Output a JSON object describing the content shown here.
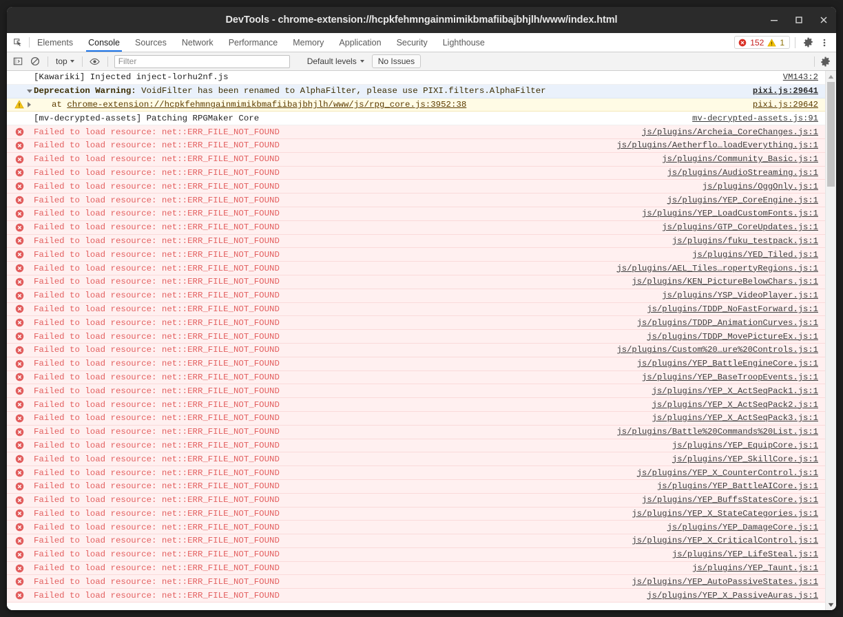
{
  "window": {
    "title": "DevTools - chrome-extension://hcpkfehmngainmimikbmafiibajbhjlh/www/index.html",
    "controls": {
      "minimize": "minimize-button",
      "maximize": "maximize-button",
      "close": "close-button"
    }
  },
  "tabbar": {
    "inspect_icon": "inspect-element-icon",
    "tabs": [
      {
        "label": "Elements",
        "active": false
      },
      {
        "label": "Console",
        "active": true
      },
      {
        "label": "Sources",
        "active": false
      },
      {
        "label": "Network",
        "active": false
      },
      {
        "label": "Performance",
        "active": false
      },
      {
        "label": "Memory",
        "active": false
      },
      {
        "label": "Application",
        "active": false
      },
      {
        "label": "Security",
        "active": false
      },
      {
        "label": "Lighthouse",
        "active": false
      }
    ],
    "error_count": "152",
    "warning_count": "1",
    "settings_icon": "gear-icon",
    "more_icon": "more-vertical-icon"
  },
  "toolbar": {
    "sidebar_icon": "console-sidebar-icon",
    "clear_icon": "clear-console-icon",
    "context": "top",
    "eye_icon": "live-expression-eye-icon",
    "filter_placeholder": "Filter",
    "filter_value": "",
    "levels": "Default levels",
    "no_issues": "No Issues",
    "settings_icon": "console-settings-gear-icon"
  },
  "colors": {
    "accent": "#1a73e8",
    "error": "#e36060",
    "error_bg": "#fff0f0",
    "warn_bg": "#fffbe5",
    "titlebar": "#2b2b2b"
  },
  "console": {
    "error_text": "Failed to load resource: net::ERR_FILE_NOT_FOUND",
    "messages": [
      {
        "level": "log",
        "text": "[Kawariki] Injected inject-lorhu2nf.js",
        "source": "VM143:2",
        "expander": "none",
        "icon": "none"
      },
      {
        "level": "warn-head",
        "text_bold": "Deprecation Warning:",
        "text": " VoidFilter has been renamed to AlphaFilter, please use PIXI.filters.AlphaFilter",
        "source": "pixi.js:29641",
        "expander": "down",
        "icon": "none"
      },
      {
        "level": "warn",
        "text": "at chrome-extension://hcpkfehmngainmimikbmafiibajbhjlh/www/js/rpg_core.js:3952:38",
        "source": "pixi.js:29642",
        "expander": "right",
        "icon": "warning",
        "indented": true
      },
      {
        "level": "log",
        "text": "[mv-decrypted-assets] Patching RPGMaker Core",
        "source": "mv-decrypted-assets.js:91",
        "expander": "none",
        "icon": "none"
      },
      {
        "level": "err",
        "text": "Failed to load resource: net::ERR_FILE_NOT_FOUND",
        "source": "js/plugins/Archeia_CoreChanges.js:1",
        "icon": "error"
      },
      {
        "level": "err",
        "text": "Failed to load resource: net::ERR_FILE_NOT_FOUND",
        "source": "js/plugins/Aetherflo…loadEverything.js:1",
        "icon": "error"
      },
      {
        "level": "err",
        "text": "Failed to load resource: net::ERR_FILE_NOT_FOUND",
        "source": "js/plugins/Community_Basic.js:1",
        "icon": "error"
      },
      {
        "level": "err",
        "text": "Failed to load resource: net::ERR_FILE_NOT_FOUND",
        "source": "js/plugins/AudioStreaming.js:1",
        "icon": "error"
      },
      {
        "level": "err",
        "text": "Failed to load resource: net::ERR_FILE_NOT_FOUND",
        "source": "js/plugins/OggOnly.js:1",
        "icon": "error"
      },
      {
        "level": "err",
        "text": "Failed to load resource: net::ERR_FILE_NOT_FOUND",
        "source": "js/plugins/YEP_CoreEngine.js:1",
        "icon": "error"
      },
      {
        "level": "err",
        "text": "Failed to load resource: net::ERR_FILE_NOT_FOUND",
        "source": "js/plugins/YEP_LoadCustomFonts.js:1",
        "icon": "error"
      },
      {
        "level": "err",
        "text": "Failed to load resource: net::ERR_FILE_NOT_FOUND",
        "source": "js/plugins/GTP_CoreUpdates.js:1",
        "icon": "error"
      },
      {
        "level": "err",
        "text": "Failed to load resource: net::ERR_FILE_NOT_FOUND",
        "source": "js/plugins/fuku_testpack.js:1",
        "icon": "error"
      },
      {
        "level": "err",
        "text": "Failed to load resource: net::ERR_FILE_NOT_FOUND",
        "source": "js/plugins/YED_Tiled.js:1",
        "icon": "error"
      },
      {
        "level": "err",
        "text": "Failed to load resource: net::ERR_FILE_NOT_FOUND",
        "source": "js/plugins/AEL_Tiles…ropertyRegions.js:1",
        "icon": "error"
      },
      {
        "level": "err",
        "text": "Failed to load resource: net::ERR_FILE_NOT_FOUND",
        "source": "js/plugins/KEN_PictureBelowChars.js:1",
        "icon": "error"
      },
      {
        "level": "err",
        "text": "Failed to load resource: net::ERR_FILE_NOT_FOUND",
        "source": "js/plugins/YSP_VideoPlayer.js:1",
        "icon": "error"
      },
      {
        "level": "err",
        "text": "Failed to load resource: net::ERR_FILE_NOT_FOUND",
        "source": "js/plugins/TDDP_NoFastForward.js:1",
        "icon": "error"
      },
      {
        "level": "err",
        "text": "Failed to load resource: net::ERR_FILE_NOT_FOUND",
        "source": "js/plugins/TDDP_AnimationCurves.js:1",
        "icon": "error"
      },
      {
        "level": "err",
        "text": "Failed to load resource: net::ERR_FILE_NOT_FOUND",
        "source": "js/plugins/TDDP_MovePictureEx.js:1",
        "icon": "error"
      },
      {
        "level": "err",
        "text": "Failed to load resource: net::ERR_FILE_NOT_FOUND",
        "source": "js/plugins/Custom%20…ure%20Controls.js:1",
        "icon": "error"
      },
      {
        "level": "err",
        "text": "Failed to load resource: net::ERR_FILE_NOT_FOUND",
        "source": "js/plugins/YEP_BattleEngineCore.js:1",
        "icon": "error"
      },
      {
        "level": "err",
        "text": "Failed to load resource: net::ERR_FILE_NOT_FOUND",
        "source": "js/plugins/YEP_BaseTroopEvents.js:1",
        "icon": "error"
      },
      {
        "level": "err",
        "text": "Failed to load resource: net::ERR_FILE_NOT_FOUND",
        "source": "js/plugins/YEP_X_ActSeqPack1.js:1",
        "icon": "error"
      },
      {
        "level": "err",
        "text": "Failed to load resource: net::ERR_FILE_NOT_FOUND",
        "source": "js/plugins/YEP_X_ActSeqPack2.js:1",
        "icon": "error"
      },
      {
        "level": "err",
        "text": "Failed to load resource: net::ERR_FILE_NOT_FOUND",
        "source": "js/plugins/YEP_X_ActSeqPack3.js:1",
        "icon": "error"
      },
      {
        "level": "err",
        "text": "Failed to load resource: net::ERR_FILE_NOT_FOUND",
        "source": "js/plugins/Battle%20Commands%20List.js:1",
        "icon": "error"
      },
      {
        "level": "err",
        "text": "Failed to load resource: net::ERR_FILE_NOT_FOUND",
        "source": "js/plugins/YEP_EquipCore.js:1",
        "icon": "error"
      },
      {
        "level": "err",
        "text": "Failed to load resource: net::ERR_FILE_NOT_FOUND",
        "source": "js/plugins/YEP_SkillCore.js:1",
        "icon": "error"
      },
      {
        "level": "err",
        "text": "Failed to load resource: net::ERR_FILE_NOT_FOUND",
        "source": "js/plugins/YEP_X_CounterControl.js:1",
        "icon": "error"
      },
      {
        "level": "err",
        "text": "Failed to load resource: net::ERR_FILE_NOT_FOUND",
        "source": "js/plugins/YEP_BattleAICore.js:1",
        "icon": "error"
      },
      {
        "level": "err",
        "text": "Failed to load resource: net::ERR_FILE_NOT_FOUND",
        "source": "js/plugins/YEP_BuffsStatesCore.js:1",
        "icon": "error"
      },
      {
        "level": "err",
        "text": "Failed to load resource: net::ERR_FILE_NOT_FOUND",
        "source": "js/plugins/YEP_X_StateCategories.js:1",
        "icon": "error"
      },
      {
        "level": "err",
        "text": "Failed to load resource: net::ERR_FILE_NOT_FOUND",
        "source": "js/plugins/YEP_DamageCore.js:1",
        "icon": "error"
      },
      {
        "level": "err",
        "text": "Failed to load resource: net::ERR_FILE_NOT_FOUND",
        "source": "js/plugins/YEP_X_CriticalControl.js:1",
        "icon": "error"
      },
      {
        "level": "err",
        "text": "Failed to load resource: net::ERR_FILE_NOT_FOUND",
        "source": "js/plugins/YEP_LifeSteal.js:1",
        "icon": "error"
      },
      {
        "level": "err",
        "text": "Failed to load resource: net::ERR_FILE_NOT_FOUND",
        "source": "js/plugins/YEP_Taunt.js:1",
        "icon": "error"
      },
      {
        "level": "err",
        "text": "Failed to load resource: net::ERR_FILE_NOT_FOUND",
        "source": "js/plugins/YEP_AutoPassiveStates.js:1",
        "icon": "error"
      },
      {
        "level": "err",
        "text": "Failed to load resource: net::ERR_FILE_NOT_FOUND",
        "source": "js/plugins/YEP_X_PassiveAuras.js:1",
        "icon": "error"
      }
    ]
  }
}
